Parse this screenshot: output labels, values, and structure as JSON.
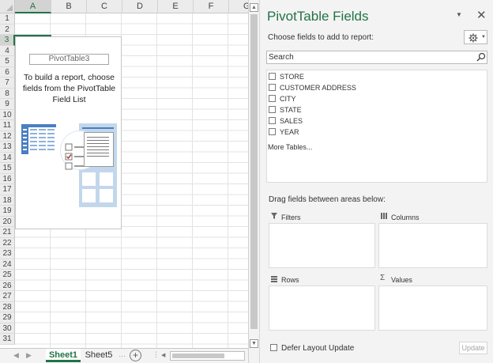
{
  "sheet": {
    "columns": [
      "A",
      "B",
      "C",
      "D",
      "E",
      "F",
      "G"
    ],
    "rows": [
      "1",
      "2",
      "3",
      "4",
      "5",
      "6",
      "7",
      "8",
      "9",
      "10",
      "11",
      "12",
      "13",
      "14",
      "15",
      "16",
      "17",
      "18",
      "19",
      "20",
      "21",
      "22",
      "23",
      "24",
      "25",
      "26",
      "27",
      "28",
      "29",
      "30",
      "31"
    ],
    "selected_column": "A",
    "selected_row": "3"
  },
  "pivot_placeholder": {
    "name": "PivotTable3",
    "instructions": "To build a report, choose fields from the PivotTable Field List"
  },
  "tabs": {
    "items": [
      "Sheet1",
      "Sheet5"
    ],
    "active": "Sheet1",
    "add_label": "+"
  },
  "pane": {
    "title": "PivotTable Fields",
    "choose_label": "Choose fields to add to report:",
    "search_placeholder": "Search",
    "fields": [
      "STORE",
      "CUSTOMER ADDRESS",
      "CITY",
      "STATE",
      "SALES",
      "YEAR"
    ],
    "more_tables": "More Tables...",
    "drag_label": "Drag fields between areas below:",
    "areas": {
      "filters": "Filters",
      "columns": "Columns",
      "rows": "Rows",
      "values": "Values"
    },
    "defer_label": "Defer Layout Update",
    "update_label": "Update"
  },
  "icons": [
    "gear-icon",
    "search-icon",
    "close-icon",
    "filter-icon",
    "columns-icon",
    "rows-icon",
    "sigma-icon"
  ],
  "colors": {
    "accent": "#217346",
    "illustration_blue": "#4a7fc1"
  }
}
